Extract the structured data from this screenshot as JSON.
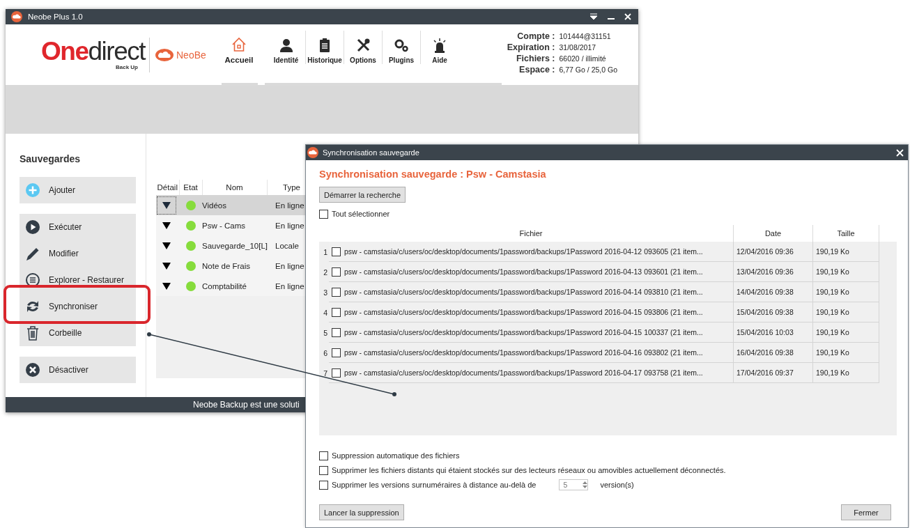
{
  "main_window": {
    "title": "Neobe Plus 1.0",
    "logo": {
      "accent": "One",
      "rest": "direct",
      "tagline": "Back Up"
    },
    "product": "NeoBe",
    "nav": [
      {
        "label": "Accueil",
        "selected": true
      },
      {
        "label": "Identité",
        "selected": false
      },
      {
        "label": "Historique",
        "selected": false
      },
      {
        "label": "Options",
        "selected": false
      },
      {
        "label": "Plugins",
        "selected": false
      },
      {
        "label": "Aide",
        "selected": false
      }
    ],
    "account": [
      {
        "label": "Compte :",
        "value": "101444@31151"
      },
      {
        "label": "Expiration :",
        "value": "31/08/2017"
      },
      {
        "label": "Fichiers :",
        "value": "66020 / illimité"
      },
      {
        "label": "Espace :",
        "value": "6,77 Go / 25,0 Go"
      }
    ],
    "sidebar": {
      "title": "Sauvegardes",
      "groups": [
        {
          "items": [
            {
              "label": "Ajouter",
              "highlighted": false
            }
          ]
        },
        {
          "items": [
            {
              "label": "Exécuter",
              "highlighted": false
            },
            {
              "label": "Modifier",
              "highlighted": false
            },
            {
              "label": "Explorer - Restaurer",
              "highlighted": false
            },
            {
              "label": "Synchroniser",
              "highlighted": true
            },
            {
              "label": "Corbeille",
              "highlighted": false
            }
          ]
        },
        {
          "items": [
            {
              "label": "Désactiver",
              "highlighted": false
            }
          ]
        }
      ]
    },
    "table": {
      "columns": [
        "Détail",
        "Etat",
        "Nom",
        "Type"
      ],
      "rows": [
        {
          "name": "Vidéos",
          "type": "En ligne",
          "selected": true
        },
        {
          "name": "Psw - Cams",
          "type": "En ligne",
          "selected": false
        },
        {
          "name": "Sauvegarde_10[L]",
          "type": "Locale",
          "selected": false
        },
        {
          "name": "Note de Frais",
          "type": "En ligne",
          "selected": false
        },
        {
          "name": "Comptabilité",
          "type": "En ligne",
          "selected": false
        }
      ]
    },
    "status_bar": "Neobe Backup est une soluti"
  },
  "dialog": {
    "title": "Synchronisation sauvegarde",
    "heading": "Synchronisation sauvegarde : Psw - Camstasia",
    "search_button": "Démarrer la recherche",
    "select_all": {
      "label": "Tout sélectionner",
      "checked": false
    },
    "table": {
      "columns": [
        "Fichier",
        "Date",
        "Taille"
      ],
      "rows": [
        {
          "number": "1",
          "file": "psw - camstasia/c/users/oc/desktop/documents/1password/backups/1Password 2016-04-12 093605 (21 item...",
          "date": "12/04/2016 09:36",
          "size": "190,19 Ko",
          "checked": false
        },
        {
          "number": "2",
          "file": "psw - camstasia/c/users/oc/desktop/documents/1password/backups/1Password 2016-04-13 093601 (21 item...",
          "date": "13/04/2016 09:36",
          "size": "190,19 Ko",
          "checked": false
        },
        {
          "number": "3",
          "file": "psw - camstasia/c/users/oc/desktop/documents/1password/backups/1Password 2016-04-14 093810 (21 item...",
          "date": "14/04/2016 09:38",
          "size": "190,19 Ko",
          "checked": false
        },
        {
          "number": "4",
          "file": "psw - camstasia/c/users/oc/desktop/documents/1password/backups/1Password 2016-04-15 093806 (21 item...",
          "date": "15/04/2016 09:38",
          "size": "190,19 Ko",
          "checked": false
        },
        {
          "number": "5",
          "file": "psw - camstasia/c/users/oc/desktop/documents/1password/backups/1Password 2016-04-15 100337 (21 item...",
          "date": "15/04/2016 10:03",
          "size": "190,19 Ko",
          "checked": false
        },
        {
          "number": "6",
          "file": "psw - camstasia/c/users/oc/desktop/documents/1password/backups/1Password 2016-04-16 093802 (21 item...",
          "date": "16/04/2016 09:38",
          "size": "190,19 Ko",
          "checked": false
        },
        {
          "number": "7",
          "file": "psw - camstasia/c/users/oc/desktop/documents/1password/backups/1Password 2016-04-17 093758 (21 item...",
          "date": "17/04/2016 09:37",
          "size": "190,19 Ko",
          "checked": false
        }
      ]
    },
    "options": [
      {
        "kind": "plain",
        "label": "Suppression automatique des fichiers",
        "checked": false
      },
      {
        "kind": "plain",
        "label": "Supprimer les fichiers distants qui étaient stockés sur des lecteurs réseaux ou amovibles actuellement déconnectés.",
        "checked": false
      },
      {
        "kind": "spin",
        "label": "Supprimer les versions surnuméraires à distance au-delà de",
        "checked": false,
        "value": "5",
        "unit": "version(s)"
      }
    ],
    "delete_button": "Lancer la suppression",
    "close_button": "Fermer"
  }
}
